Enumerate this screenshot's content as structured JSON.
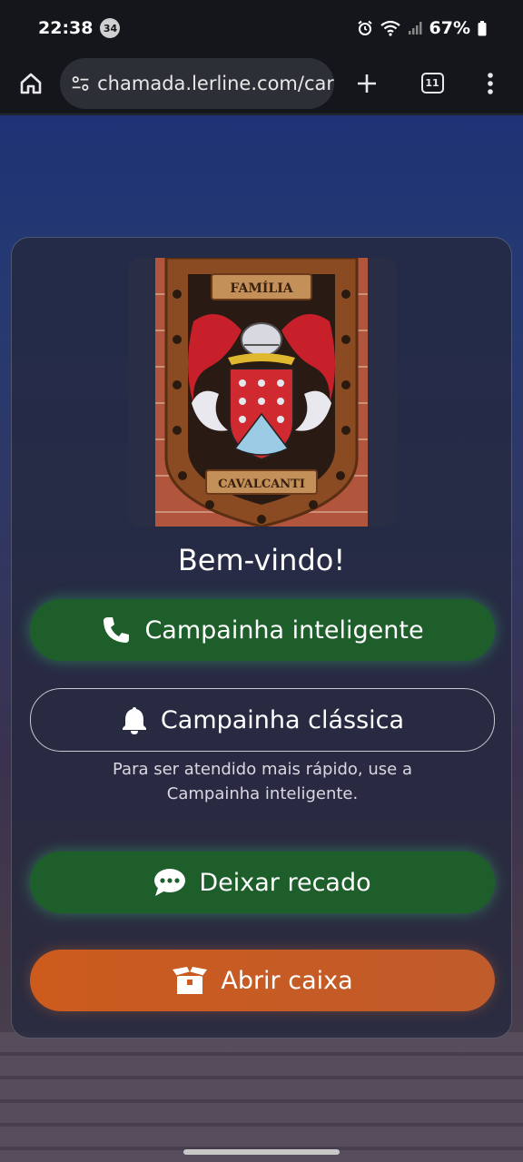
{
  "status_bar": {
    "time": "22:38",
    "notification_count": "34",
    "battery": "67%"
  },
  "browser": {
    "url": "chamada.lerline.com/car",
    "tab_count": "11"
  },
  "crest": {
    "top_text": "FAMÍLIA",
    "bottom_text": "CAVALCANTI"
  },
  "main": {
    "welcome": "Bem-vindo!",
    "smart_bell_label": "Campainha inteligente",
    "classic_bell_label": "Campainha clássica",
    "hint_line1": "Para ser atendido mais rápido, use a",
    "hint_line2": "Campainha inteligente.",
    "message_label": "Deixar recado",
    "open_box_label": "Abrir caixa"
  },
  "colors": {
    "green_button": "#1d5e2b",
    "orange_button": "#cc5b1d",
    "card_bg": "#24283e"
  }
}
